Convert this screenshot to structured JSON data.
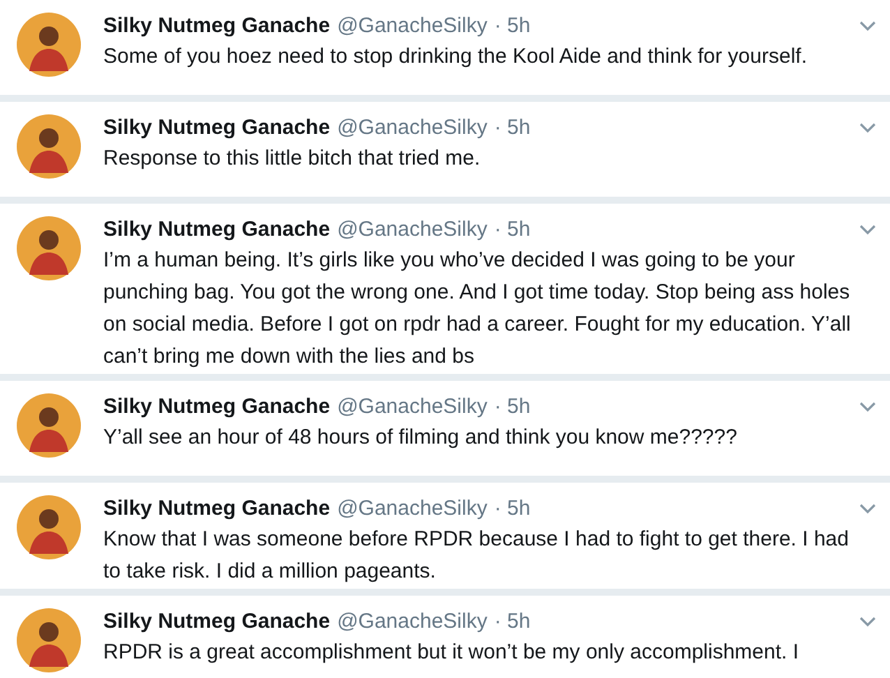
{
  "tweets": [
    {
      "name": "Silky Nutmeg Ganache",
      "handle": "@GanacheSilky",
      "time": "· 5h",
      "text": "Some of you hoez need to stop drinking the Kool Aide and think for yourself."
    },
    {
      "name": "Silky Nutmeg Ganache",
      "handle": "@GanacheSilky",
      "time": "· 5h",
      "text": "Response to this little bitch that tried me."
    },
    {
      "name": "Silky Nutmeg Ganache",
      "handle": "@GanacheSilky",
      "time": "· 5h",
      "text": "I’m a human being. It’s girls like you who’ve decided I was going to be your punching bag. You got the wrong one. And I got time today. Stop being ass holes on social media. Before I got on rpdr had a career. Fought for my education. Y’all can’t bring me down with the lies and bs"
    },
    {
      "name": "Silky Nutmeg Ganache",
      "handle": "@GanacheSilky",
      "time": "· 5h",
      "text": "Y’all see an hour of 48 hours of filming and think you know me?????"
    },
    {
      "name": "Silky Nutmeg Ganache",
      "handle": "@GanacheSilky",
      "time": "· 5h",
      "text": "Know that I was someone before RPDR because I had to fight to get there. I had to take risk. I did a million pageants."
    },
    {
      "name": "Silky Nutmeg Ganache",
      "handle": "@GanacheSilky",
      "time": "· 5h",
      "text": "RPDR is a great accomplishment but it won’t be my only accomplishment. I"
    }
  ]
}
